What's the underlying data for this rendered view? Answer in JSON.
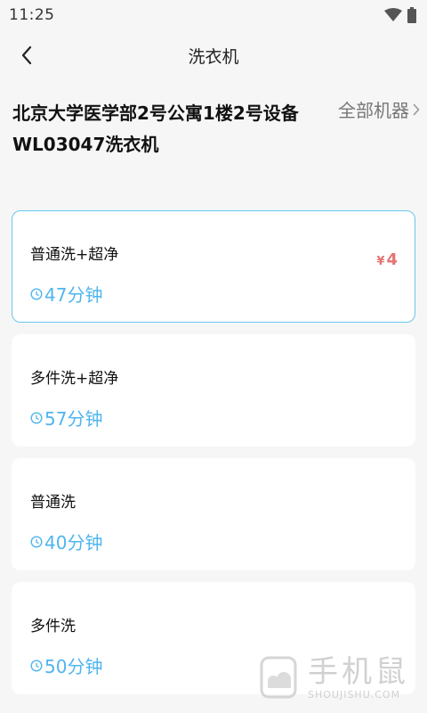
{
  "status_bar": {
    "time": "11:25"
  },
  "nav": {
    "title": "洗衣机"
  },
  "device": {
    "location": "北京大学医学部2号公寓1楼2号设备",
    "name": "WL03047洗衣机",
    "all_machines_label": "全部机器"
  },
  "programs": [
    {
      "name": "普通洗+超净",
      "duration": "47分钟",
      "price_symbol": "¥",
      "price": "4",
      "selected": true
    },
    {
      "name": "多件洗+超净",
      "duration": "57分钟"
    },
    {
      "name": "普通洗",
      "duration": "40分钟"
    },
    {
      "name": "多件洗",
      "duration": "50分钟"
    }
  ],
  "watermark": {
    "main": "手机鼠",
    "sub": "SHOUJISHU.COM"
  },
  "colors": {
    "accent": "#4fb5ee",
    "price": "#e57373",
    "selected_border": "#6ac6ee",
    "background": "#f6f6f6"
  }
}
